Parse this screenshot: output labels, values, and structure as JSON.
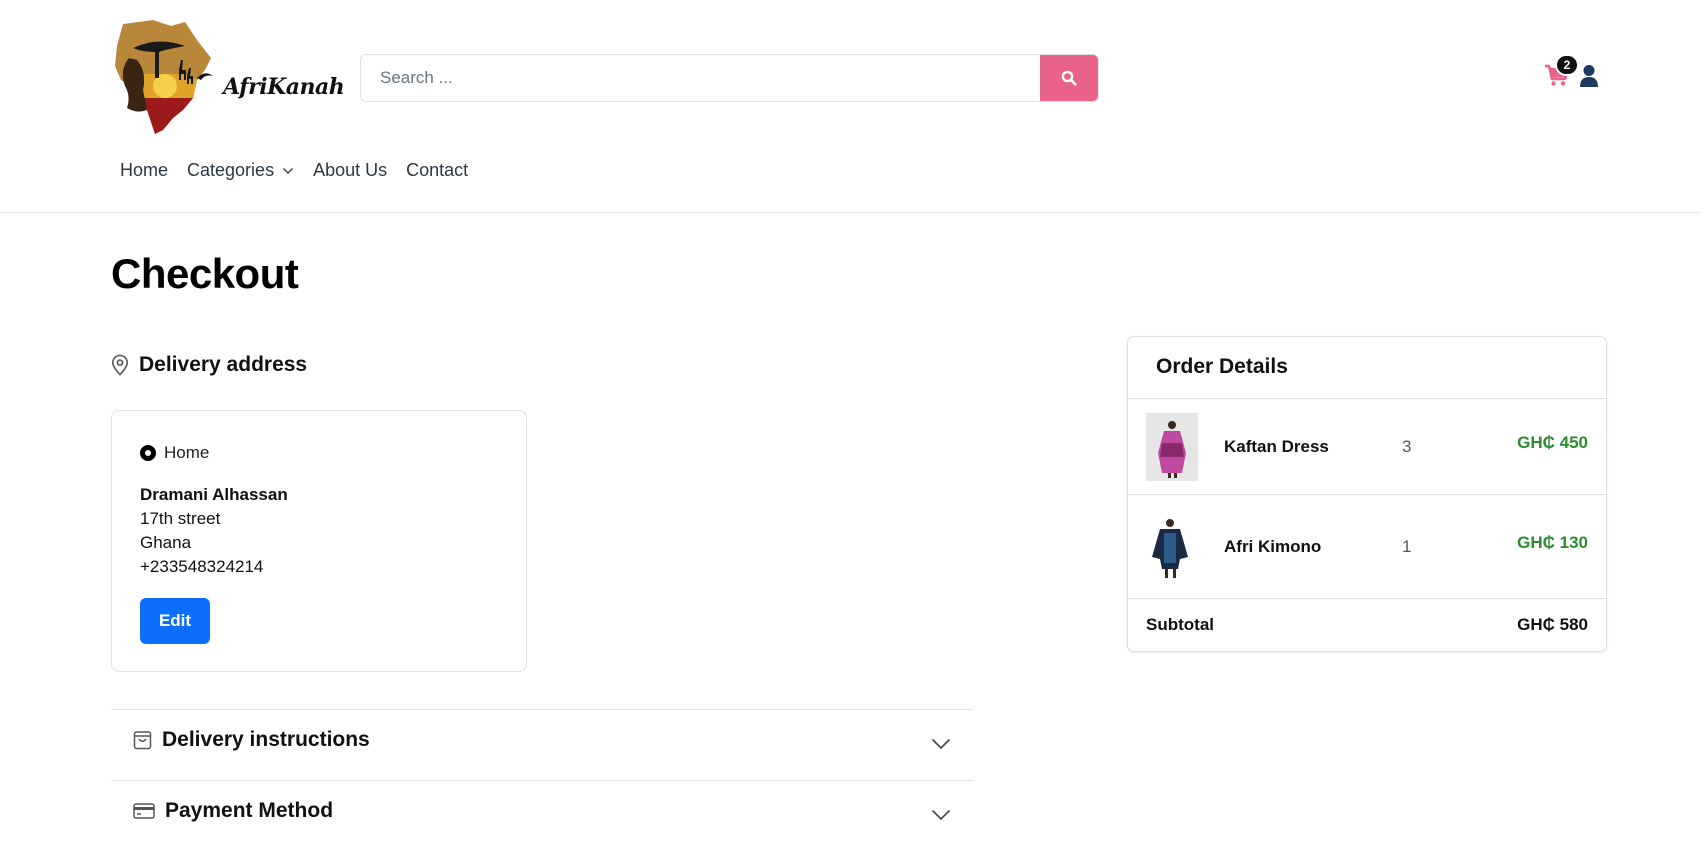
{
  "brand": {
    "name": "AfriKanah"
  },
  "search": {
    "placeholder": "Search ..."
  },
  "header": {
    "cart_count": "2"
  },
  "nav": {
    "home": "Home",
    "categories": "Categories",
    "about": "About Us",
    "contact": "Contact"
  },
  "page": {
    "title": "Checkout"
  },
  "delivery": {
    "heading": "Delivery address",
    "address": {
      "label": "Home",
      "name": "Dramani Alhassan",
      "street": "17th street",
      "country": "Ghana",
      "phone": "+233548324214",
      "edit_label": "Edit"
    }
  },
  "accordions": {
    "instructions": "Delivery instructions",
    "payment": "Payment Method"
  },
  "order": {
    "title": "Order Details",
    "items": [
      {
        "name": "Kaftan Dress",
        "qty": "3",
        "price": "GH₵ 450"
      },
      {
        "name": "Afri Kimono",
        "qty": "1",
        "price": "GH₵ 130"
      }
    ],
    "subtotal_label": "Subtotal",
    "subtotal_value": "GH₵ 580"
  },
  "colors": {
    "accent_pink": "#e8628a",
    "primary_blue": "#0d6efd",
    "price_green": "#2e8b2e"
  },
  "icons": {
    "search": "search-icon",
    "cart": "cart-icon",
    "user": "user-icon",
    "location": "location-pin-icon",
    "bag": "shopping-bag-icon",
    "card": "credit-card-icon",
    "chevron": "chevron-down-icon"
  }
}
